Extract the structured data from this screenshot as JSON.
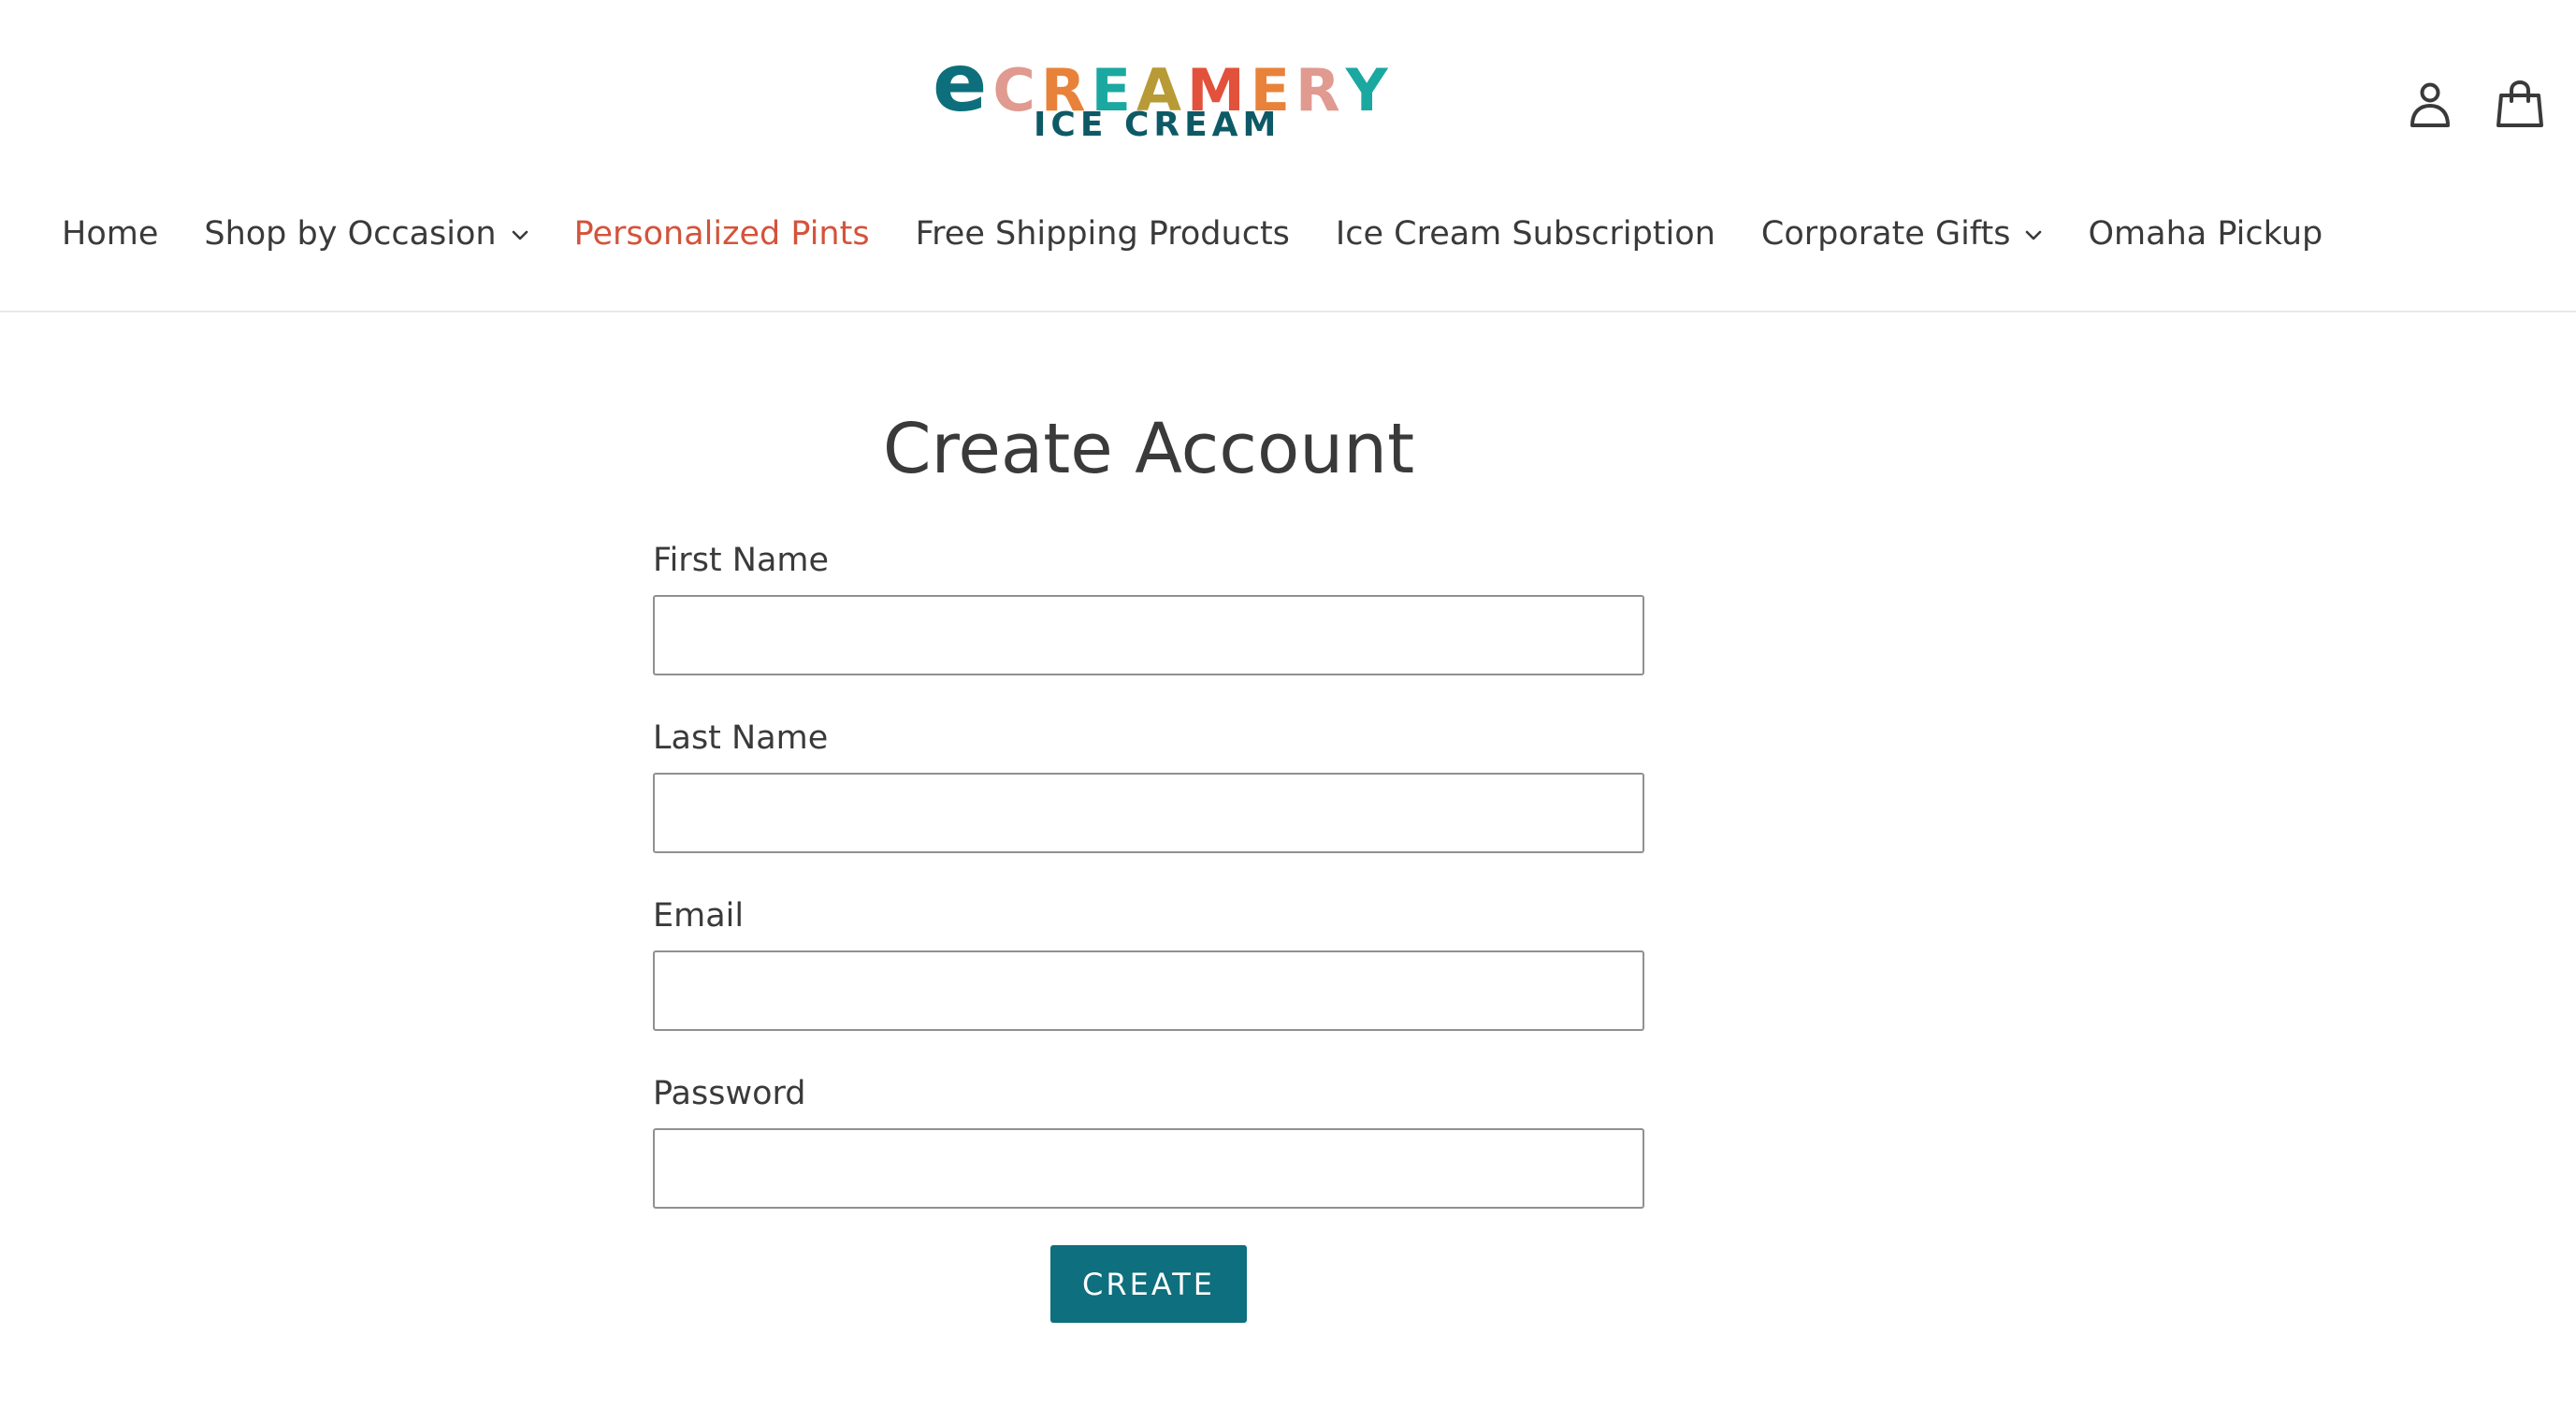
{
  "brand": {
    "logo_first_letter": "e",
    "logo_letters": [
      {
        "char": "C",
        "color": "#e09a8f"
      },
      {
        "char": "R",
        "color": "#e8823a"
      },
      {
        "char": "E",
        "color": "#1aa8a0"
      },
      {
        "char": "A",
        "color": "#b89a36"
      },
      {
        "char": "M",
        "color": "#e2513b"
      },
      {
        "char": "E",
        "color": "#e8823a"
      },
      {
        "char": "R",
        "color": "#e09a8f"
      },
      {
        "char": "Y",
        "color": "#1aa8a0"
      }
    ],
    "logo_first_color": "#0d6f7b",
    "logo_subtitle": "ICE CREAM",
    "logo_subtitle_color": "#0d5a66"
  },
  "header": {
    "account_icon": "user-icon",
    "cart_icon": "shopping-bag-icon"
  },
  "nav": {
    "items": [
      {
        "label": "Home",
        "has_dropdown": false,
        "active": false
      },
      {
        "label": "Shop by Occasion",
        "has_dropdown": true,
        "active": false
      },
      {
        "label": "Personalized Pints",
        "has_dropdown": false,
        "active": true
      },
      {
        "label": "Free Shipping Products",
        "has_dropdown": false,
        "active": false
      },
      {
        "label": "Ice Cream Subscription",
        "has_dropdown": false,
        "active": false
      },
      {
        "label": "Corporate Gifts",
        "has_dropdown": true,
        "active": false
      },
      {
        "label": "Omaha Pickup",
        "has_dropdown": false,
        "active": false
      }
    ],
    "active_color": "#d4533a"
  },
  "form": {
    "title": "Create Account",
    "first_name_label": "First Name",
    "first_name_value": "",
    "last_name_label": "Last Name",
    "last_name_value": "",
    "email_label": "Email",
    "email_value": "",
    "password_label": "Password",
    "password_value": "",
    "submit_label": "CREATE",
    "accent_color": "#0e6f7e"
  }
}
